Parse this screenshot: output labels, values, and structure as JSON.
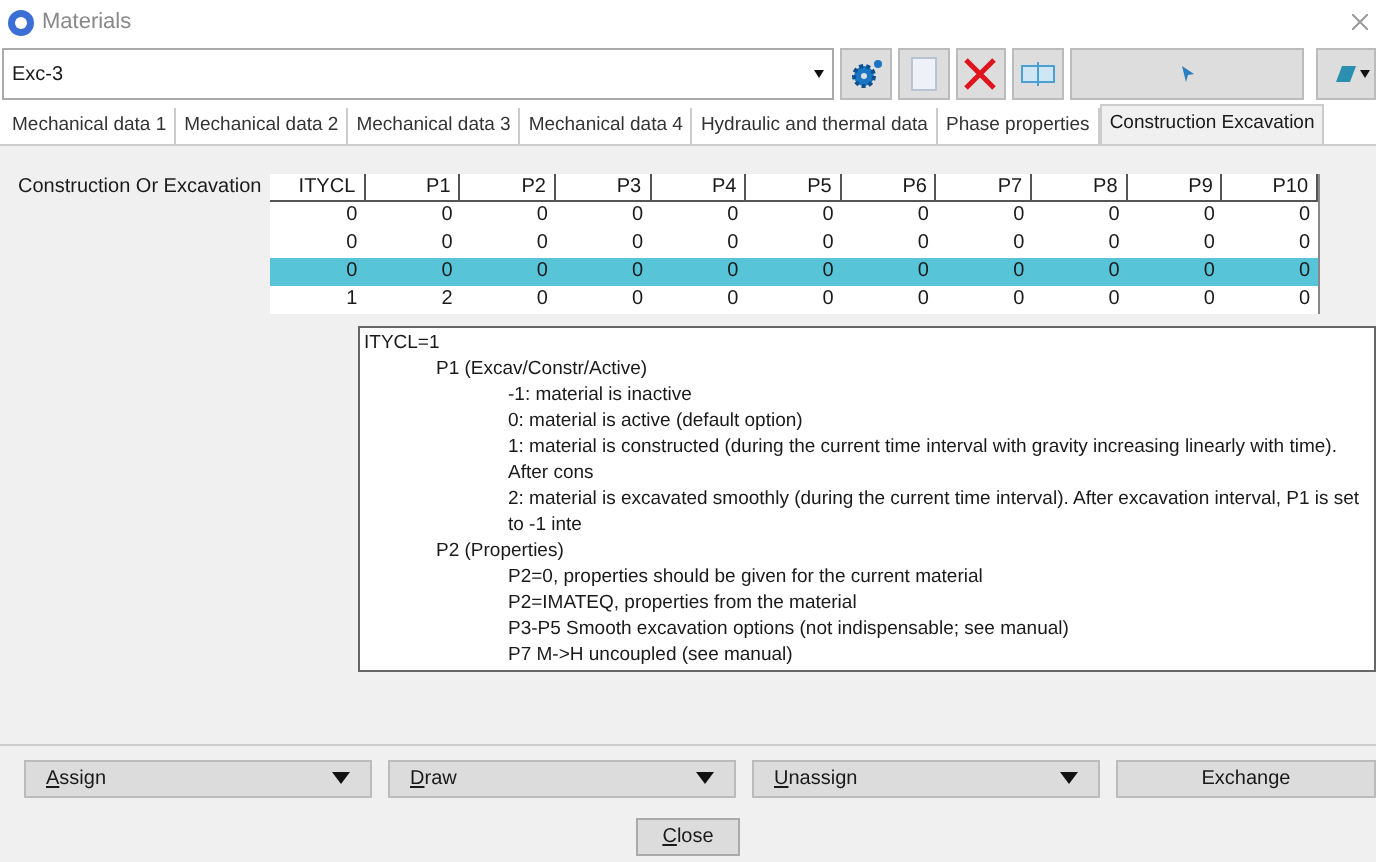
{
  "window": {
    "title": "Materials"
  },
  "material_select": {
    "value": "Exc-3"
  },
  "tabs": [
    {
      "label": "Mechanical data 1",
      "selected": false
    },
    {
      "label": "Mechanical data 2",
      "selected": false
    },
    {
      "label": "Mechanical data 3",
      "selected": false
    },
    {
      "label": "Mechanical data 4",
      "selected": false
    },
    {
      "label": "Hydraulic and thermal data",
      "selected": false
    },
    {
      "label": "Phase properties",
      "selected": false
    },
    {
      "label": "Construction Excavation",
      "selected": true
    }
  ],
  "field_label": "Construction Or Excavation",
  "table": {
    "columns": [
      "ITYCL",
      "P1",
      "P2",
      "P3",
      "P4",
      "P5",
      "P6",
      "P7",
      "P8",
      "P9",
      "P10"
    ],
    "rows": [
      {
        "cells": [
          "0",
          "0",
          "0",
          "0",
          "0",
          "0",
          "0",
          "0",
          "0",
          "0",
          "0"
        ],
        "selected": false
      },
      {
        "cells": [
          "0",
          "0",
          "0",
          "0",
          "0",
          "0",
          "0",
          "0",
          "0",
          "0",
          "0"
        ],
        "selected": false
      },
      {
        "cells": [
          "0",
          "0",
          "0",
          "0",
          "0",
          "0",
          "0",
          "0",
          "0",
          "0",
          "0"
        ],
        "selected": true
      },
      {
        "cells": [
          "1",
          "2",
          "0",
          "0",
          "0",
          "0",
          "0",
          "0",
          "0",
          "0",
          "0"
        ],
        "selected": false
      }
    ]
  },
  "tooltip": {
    "lines": [
      {
        "text": "ITYCL=1",
        "children": [
          {
            "text": "P1 (Excav/Constr/Active)",
            "children": [
              {
                "text": "-1: material is inactive"
              },
              {
                "text": "0: material is active (default option)"
              },
              {
                "text": "1: material is constructed (during the current time interval with gravity increasing linearly with time). After cons"
              },
              {
                "text": "2: material is excavated smoothly (during the current time interval). After excavation interval, P1 is set to -1 inte"
              }
            ]
          },
          {
            "text": "P2 (Properties)",
            "children": [
              {
                "text": "P2=0, properties should be given for the current material"
              },
              {
                "text": "P2=IMATEQ, properties from the material"
              },
              {
                "text": "P3-P5 Smooth excavation options (not indispensable; see manual)"
              },
              {
                "text": "P7 M->H uncoupled (see manual)"
              }
            ]
          }
        ]
      }
    ]
  },
  "action_buttons": [
    {
      "label": "Assign",
      "kind": "dropdown",
      "underlined_first": true
    },
    {
      "label": "Draw",
      "kind": "dropdown",
      "underlined_first": true
    },
    {
      "label": "Unassign",
      "kind": "dropdown",
      "underlined_first": true
    },
    {
      "label": "Exchange",
      "kind": "plain",
      "underlined_first": false
    }
  ],
  "close_button": {
    "label": "Close",
    "underlined_first": true
  }
}
